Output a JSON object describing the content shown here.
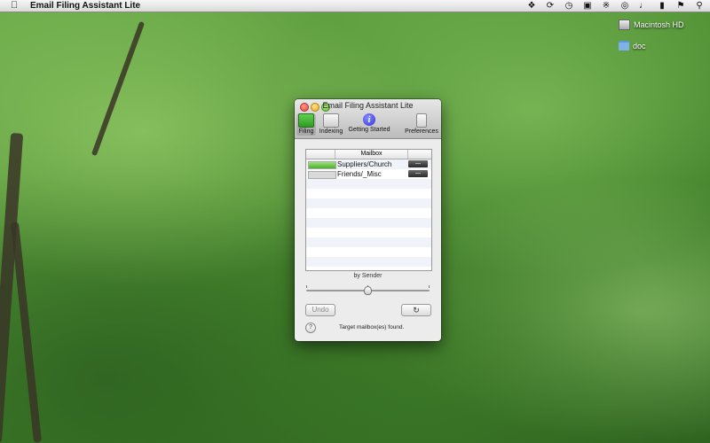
{
  "menubar": {
    "apple_icon": "apple-icon",
    "app_name": "Email Filing Assistant Lite",
    "status_icons": [
      "dropbox-icon",
      "sync-icon",
      "time-machine-icon",
      "display-icon",
      "bluetooth-icon",
      "wifi-icon",
      "volume-icon",
      "battery-icon",
      "flag-icon",
      "spotlight-icon"
    ]
  },
  "desktop": {
    "icons": [
      {
        "label": "Macintosh HD",
        "icon": "hard-disk-icon"
      },
      {
        "label": "doc",
        "icon": "folder-icon"
      }
    ]
  },
  "window": {
    "title": "Email Filing Assistant Lite",
    "toolbar": [
      {
        "label": "Filing",
        "icon": "filing-icon",
        "selected": true
      },
      {
        "label": "Indexing",
        "icon": "indexing-icon"
      },
      {
        "label": "Getting Started",
        "icon": "info-icon"
      },
      {
        "label": "Preferences",
        "icon": "preferences-icon"
      }
    ],
    "table": {
      "header": "Mailbox",
      "rows": [
        {
          "mailbox": "Suppliers/Church",
          "match": 1.0
        },
        {
          "mailbox": "Friends/_Misc",
          "match": 0.0
        }
      ]
    },
    "slider_label": "by Sender",
    "slider_value": 0.5,
    "undo_label": "Undo",
    "refresh_icon": "refresh-icon",
    "help_label": "?",
    "status_text": "Target mailbox(es) found."
  },
  "colors": {
    "match_bar": "#4dae2c",
    "window_bg": "#ececec"
  }
}
